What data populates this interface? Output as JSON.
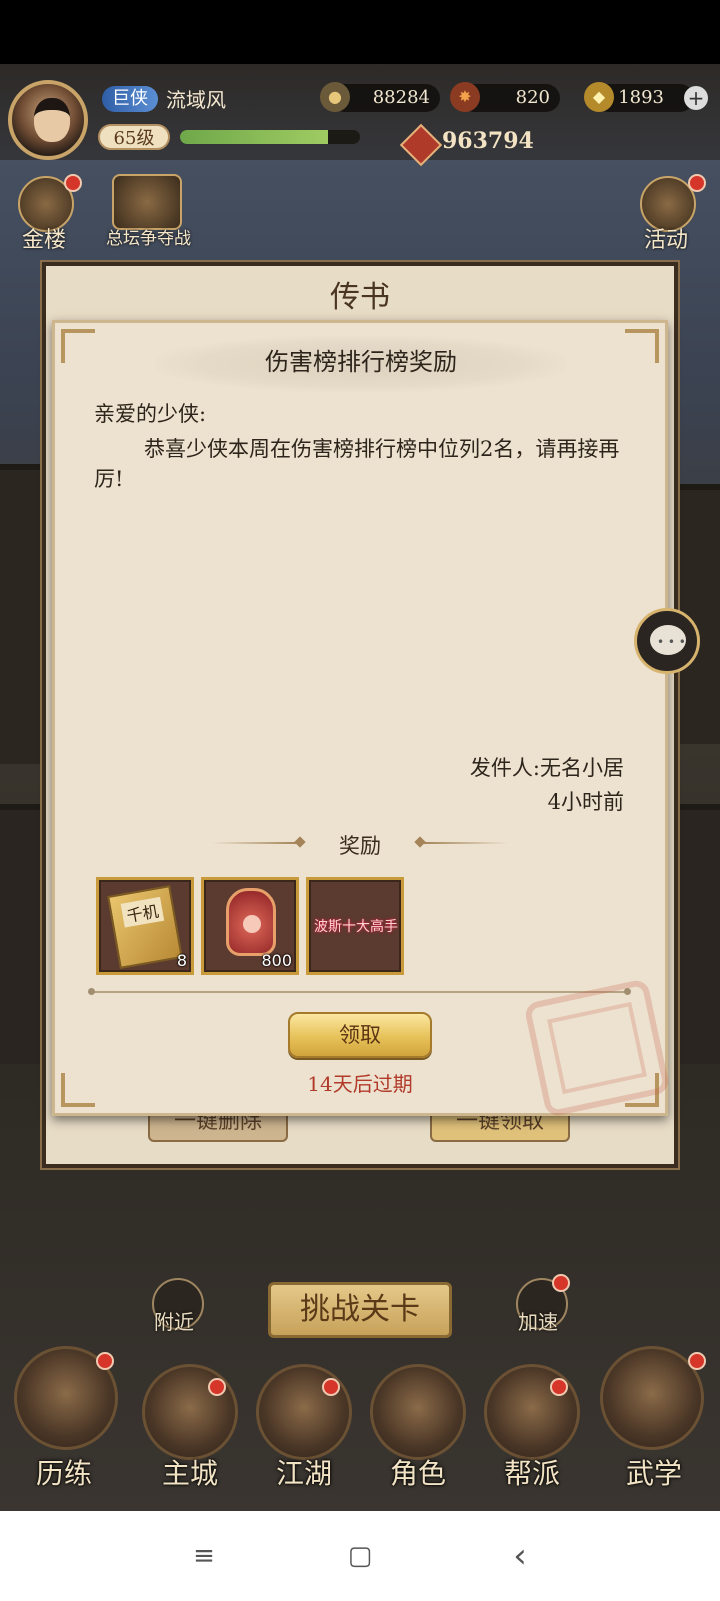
{
  "status_bar": {},
  "player": {
    "rank": "巨侠",
    "name": "流域风",
    "level": "65级",
    "xp_fraction": 0.82,
    "power": "963794"
  },
  "resources": {
    "coins": "88284",
    "gems": "820",
    "gold": "1893"
  },
  "side_menu": {
    "left": [
      {
        "label": "金楼"
      },
      {
        "label": "总坛争夺战"
      }
    ],
    "right": [
      {
        "label": "活动"
      }
    ]
  },
  "mail_panel": {
    "title": "传书",
    "delete_all": "一键删除",
    "claim_all": "一键领取"
  },
  "dialog": {
    "title": "伤害榜排行榜奖励",
    "greeting": "亲爱的少侠:",
    "body": "恭喜少侠本周在伤害榜排行榜中位列2名，请再接再厉!",
    "sender": "发件人:无名小居",
    "time": "4小时前",
    "rewards_heading": "奖励",
    "rewards": [
      {
        "icon": "scroll-book-icon",
        "text": "千机",
        "count": "8"
      },
      {
        "icon": "red-emblem-icon",
        "count": "800"
      },
      {
        "icon": "title-banner-icon",
        "text": "波斯十大高手"
      }
    ],
    "claim_label": "领取",
    "expiry": "14天后过期"
  },
  "challenge_label": "挑战关卡",
  "quick": {
    "nearby": "附近",
    "speed": "加速"
  },
  "bottom_nav": [
    {
      "label": "历练"
    },
    {
      "label": "主城"
    },
    {
      "label": "江湖"
    },
    {
      "label": "角色"
    },
    {
      "label": "帮派"
    },
    {
      "label": "武学"
    }
  ],
  "android_nav": {
    "menu": "≡",
    "home": "▢",
    "back": "‹"
  },
  "colors": {
    "dialog_bg": "#ece2cf",
    "claim_button": "#e7c25a",
    "expiry_text": "#b23a2a",
    "notification_dot": "#d6362a"
  }
}
